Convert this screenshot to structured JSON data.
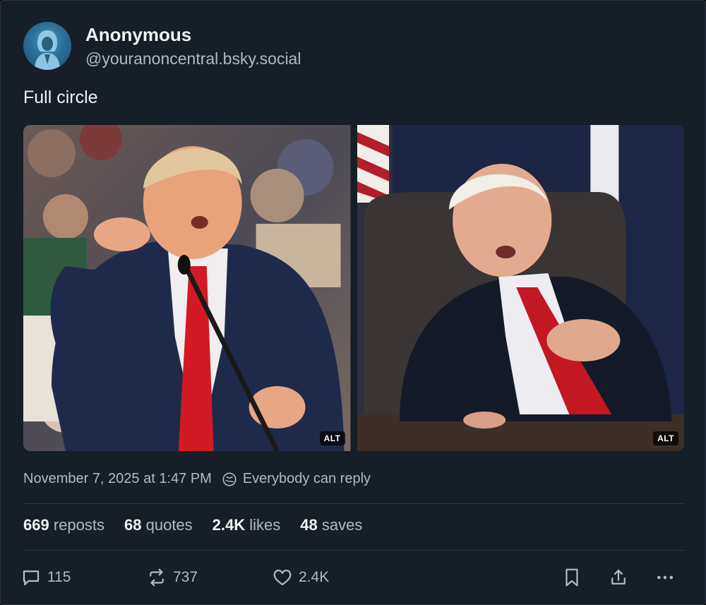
{
  "author": {
    "display_name": "Anonymous",
    "handle": "@youranoncentral.bsky.social",
    "avatar_icon": "hooded-figure-icon"
  },
  "post": {
    "text": "Full circle",
    "images": [
      {
        "alt_label": "ALT"
      },
      {
        "alt_label": "ALT"
      }
    ],
    "timestamp": "November 7, 2025 at 1:47 PM",
    "reply_setting": "Everybody can reply"
  },
  "stats": {
    "reposts_count": "669",
    "reposts_label": "reposts",
    "quotes_count": "68",
    "quotes_label": "quotes",
    "likes_count": "2.4K",
    "likes_label": "likes",
    "saves_count": "48",
    "saves_label": "saves"
  },
  "actions": {
    "reply_count": "115",
    "repost_count": "737",
    "like_count": "2.4K"
  },
  "colors": {
    "background": "#161e27",
    "text": "#f1f3f5",
    "muted": "#aebbc9",
    "divider": "#2e3947"
  }
}
